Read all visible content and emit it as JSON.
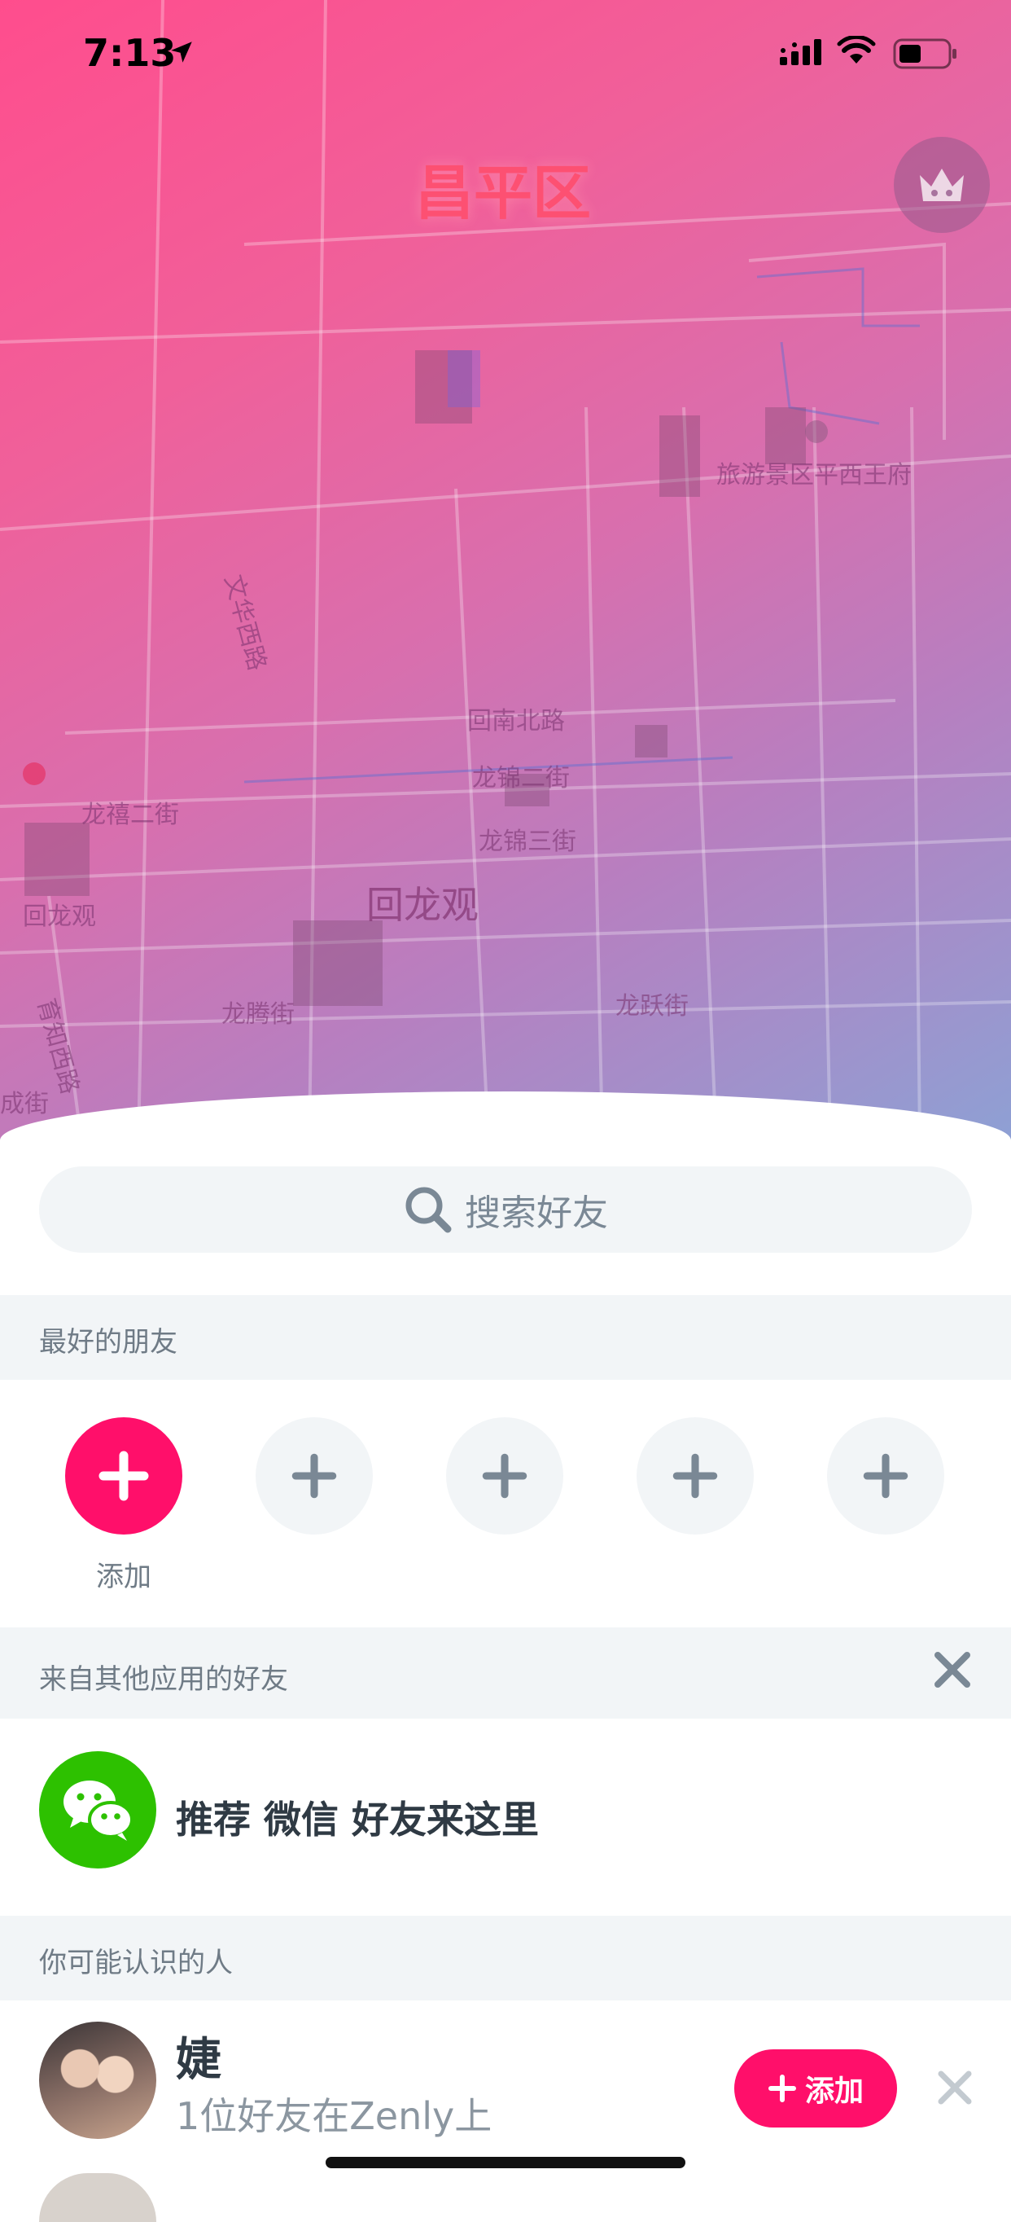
{
  "status_bar": {
    "time": "7:13"
  },
  "map": {
    "district": "昌平区",
    "area_label": "回龙观",
    "poi": "旅游景区平西王府",
    "streets": [
      "文华西路",
      "回南北路",
      "龙锦二街",
      "龙锦三街",
      "龙禧二街",
      "回龙观",
      "龙腾街",
      "龙跃街",
      "育知西路",
      "成街"
    ]
  },
  "search": {
    "placeholder": "搜索好友"
  },
  "best_friends": {
    "title": "最好的朋友",
    "add_label": "添加",
    "slot_count": 5
  },
  "other_apps": {
    "title": "来自其他应用的好友",
    "wechat_text": "推荐 微信 好友来这里"
  },
  "suggestions": {
    "title": "你可能认识的人",
    "people": [
      {
        "name": "婕",
        "subtitle": "1位好友在Zenly上",
        "add_label": "添加"
      }
    ]
  },
  "colors": {
    "accent": "#ff0f6a",
    "wechat": "#2dc100",
    "section_bg": "#f2f5f7"
  }
}
